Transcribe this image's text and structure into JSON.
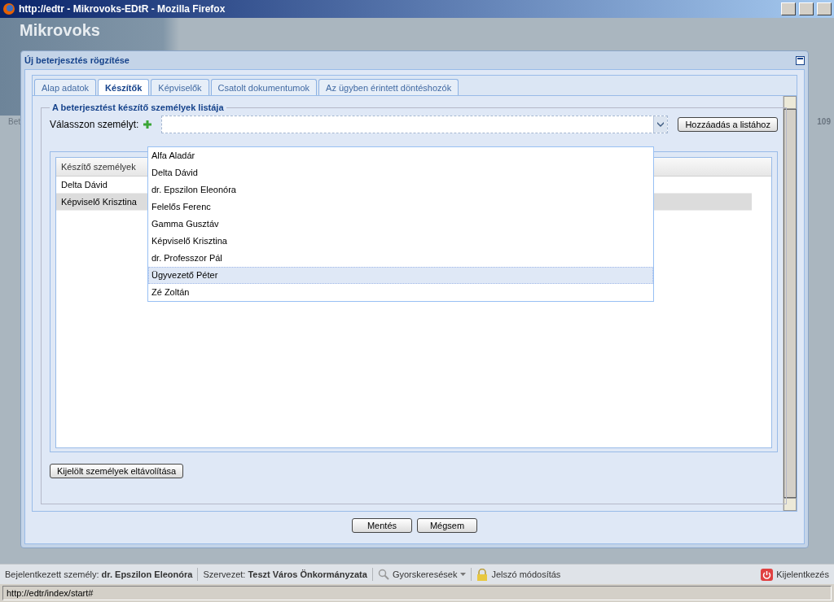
{
  "window": {
    "title": "http://edtr - Mikrovoks-EDtR - Mozilla Firefox"
  },
  "background_app": {
    "logo": "Mikrovoks",
    "left_fragment": "Bet",
    "right_fragment": "109"
  },
  "dialog": {
    "title": "Új beterjesztés rögzítése",
    "tabs": [
      {
        "label": "Alap adatok",
        "selected": false
      },
      {
        "label": "Készítők",
        "selected": true
      },
      {
        "label": "Képviselők",
        "selected": false
      },
      {
        "label": "Csatolt dokumentumok",
        "selected": false
      },
      {
        "label": "Az ügyben érintett döntéshozók",
        "selected": false
      }
    ],
    "fieldset": {
      "legend": "A beterjesztést készítő személyek listája",
      "field_label": "Válasszon személyt:",
      "add_button": "Hozzáadás a listához",
      "dropdown": [
        {
          "label": "Alfa Aladár",
          "selected": false
        },
        {
          "label": "Delta Dávid",
          "selected": false
        },
        {
          "label": "dr. Epszilon Eleonóra",
          "selected": false
        },
        {
          "label": "Felelős Ferenc",
          "selected": false
        },
        {
          "label": "Gamma Gusztáv",
          "selected": false
        },
        {
          "label": "Képviselő Krisztina",
          "selected": false
        },
        {
          "label": "dr. Professzor Pál",
          "selected": false
        },
        {
          "label": "Ügyvezető Péter",
          "selected": true
        },
        {
          "label": "Zé Zoltán",
          "selected": false
        }
      ],
      "table": {
        "columns": [
          "Készítő személyek"
        ],
        "rows": [
          {
            "name": "Delta Dávid",
            "selected": false
          },
          {
            "name": "Képviselő Krisztina",
            "selected": true
          }
        ]
      },
      "remove_button": "Kijelölt személyek eltávolítása"
    },
    "buttons": [
      "Mentés",
      "Mégsem"
    ]
  },
  "app_bar": {
    "user_label": "Bejelentkezett személy:",
    "user": "dr. Epszilon Eleonóra",
    "org_label": "Szervezet:",
    "org": "Teszt Város Önkormányzata",
    "quick_search": "Gyorskeresések",
    "password": "Jelszó módosítás",
    "logout": "Kijelentkezés"
  },
  "status_bar": {
    "url": "http://edtr/index/start#"
  }
}
